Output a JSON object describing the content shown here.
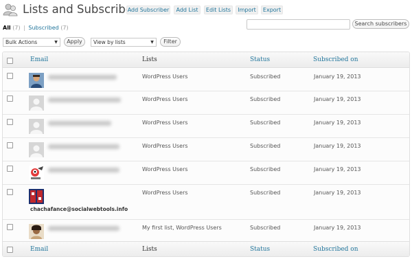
{
  "header": {
    "title": "Lists and Subscribers",
    "buttons": [
      "Add Subscriber",
      "Add List",
      "Edit Lists",
      "Import",
      "Export"
    ]
  },
  "filters": {
    "all_label": "All",
    "all_count": "(7)",
    "subscribed_label": "Subscribed",
    "subscribed_count": "(7)"
  },
  "search": {
    "button_label": "Search subscribers",
    "value": ""
  },
  "bulk": {
    "bulk_select": "Bulk Actions",
    "apply_label": "Apply",
    "list_select": "View by lists",
    "filter_label": "Filter"
  },
  "table": {
    "columns": [
      "Email",
      "Lists",
      "Status",
      "Subscribed on"
    ],
    "rows": [
      {
        "email": "",
        "lists": "WordPress Users",
        "status": "Subscribed",
        "date": "January 19, 2013",
        "avatar": "photo-avatar-icon"
      },
      {
        "email": "",
        "lists": "WordPress Users",
        "status": "Subscribed",
        "date": "January 19, 2013",
        "avatar": "default-avatar-icon"
      },
      {
        "email": "",
        "lists": "WordPress Users",
        "status": "Subscribed",
        "date": "January 19, 2013",
        "avatar": "default-avatar-icon"
      },
      {
        "email": "",
        "lists": "WordPress Users",
        "status": "Subscribed",
        "date": "January 19, 2013",
        "avatar": "default-avatar-icon"
      },
      {
        "email": "",
        "lists": "WordPress Users",
        "status": "Subscribed",
        "date": "January 19, 2013",
        "avatar": "cartoon-avatar-icon"
      },
      {
        "email": "chachafance@socialwebtools.info",
        "lists": "WordPress Users",
        "status": "Subscribed",
        "date": "January 19, 2013",
        "avatar": "logo-avatar-icon"
      },
      {
        "email": "",
        "lists": "My first list, WordPress Users",
        "status": "Subscribed",
        "date": "January 19, 2013",
        "avatar": "photo-avatar-icon"
      }
    ]
  },
  "colors": {
    "link": "#21759b",
    "header_bg": "#f1f1f1",
    "border": "#dfdfdf"
  }
}
